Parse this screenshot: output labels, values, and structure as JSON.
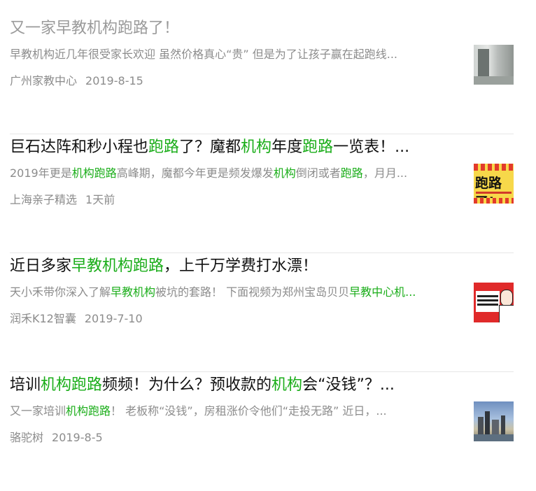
{
  "results": [
    {
      "visited": true,
      "title": [
        {
          "text": "又一家早教机构跑路了！",
          "hl": false
        }
      ],
      "summary": [
        {
          "text": "早教机构近几年很受家长欢迎 虽然价格真心“贵” 但是为了让孩子赢在起跑线...",
          "hl": false
        }
      ],
      "source": "广州家教中心",
      "date": "2019-8-15",
      "thumbnail_icon": "hallway-photo"
    },
    {
      "visited": false,
      "title": [
        {
          "text": "巨石达阵和秒小程也",
          "hl": false
        },
        {
          "text": "跑路",
          "hl": true
        },
        {
          "text": "了？魔都",
          "hl": false
        },
        {
          "text": "机构",
          "hl": true
        },
        {
          "text": "年度",
          "hl": false
        },
        {
          "text": "跑路",
          "hl": true
        },
        {
          "text": "一览表！...",
          "hl": false
        }
      ],
      "summary": [
        {
          "text": "2019年更是",
          "hl": false
        },
        {
          "text": "机构跑路",
          "hl": true
        },
        {
          "text": "高峰期，魔都今年更是频发爆发",
          "hl": false
        },
        {
          "text": "机构",
          "hl": true
        },
        {
          "text": "倒闭或者",
          "hl": false
        },
        {
          "text": "跑路",
          "hl": true
        },
        {
          "text": "，月月...",
          "hl": false
        }
      ],
      "source": "上海亲子精选",
      "date": "1天前",
      "thumbnail_icon": "poster-photo",
      "thumbnail_text": "跑路了!"
    },
    {
      "visited": false,
      "title": [
        {
          "text": "近日多家",
          "hl": false
        },
        {
          "text": "早教机构跑路",
          "hl": true
        },
        {
          "text": "，上千万学费打水漂！",
          "hl": false
        }
      ],
      "summary": [
        {
          "text": "天小禾带你深入了解",
          "hl": false
        },
        {
          "text": "早教机构",
          "hl": true
        },
        {
          "text": "被坑的套路！ 下面视频为郑州宝岛贝贝",
          "hl": false
        },
        {
          "text": "早教中心机...",
          "hl": true
        }
      ],
      "source": "润禾K12智囊",
      "date": "2019-7-10",
      "thumbnail_icon": "red-poster-photo"
    },
    {
      "visited": false,
      "title": [
        {
          "text": "培训",
          "hl": false
        },
        {
          "text": "机构跑路",
          "hl": true
        },
        {
          "text": "频频！为什么？预收款的",
          "hl": false
        },
        {
          "text": "机构",
          "hl": true
        },
        {
          "text": "会“没钱”？...",
          "hl": false
        }
      ],
      "summary": [
        {
          "text": "又一家培训",
          "hl": false
        },
        {
          "text": "机构跑路",
          "hl": true
        },
        {
          "text": "！ 老板称“没钱”，房租涨价令他们“走投无路” 近日，...",
          "hl": false
        }
      ],
      "source": "骆驼树",
      "date": "2019-8-5",
      "thumbnail_icon": "city-photo"
    }
  ],
  "colors": {
    "highlight": "#1aad19",
    "title": "#111111",
    "visited_title": "#9a9a9a",
    "meta": "#8c8c8c"
  }
}
